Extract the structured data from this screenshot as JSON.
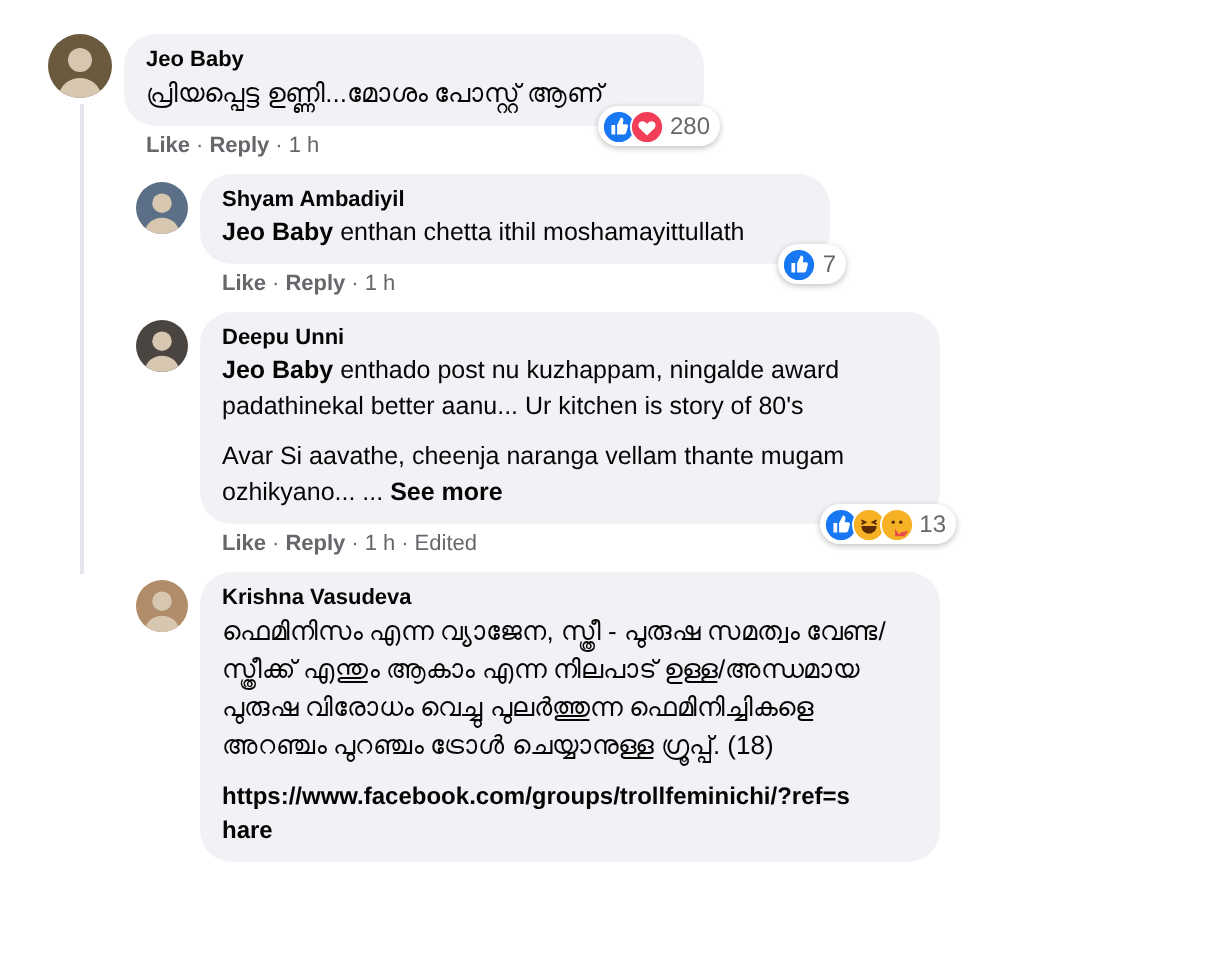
{
  "separator": "·",
  "comments": [
    {
      "author": "Jeo Baby",
      "reply": false,
      "paragraphs": [
        "പ്രിയപ്പെട്ട ഉണ്ണി...മോശം പോസ്റ്റ് ആണ്"
      ],
      "actions": [
        "Like",
        "Reply",
        "1 h"
      ],
      "reactions": {
        "icons": [
          {
            "kind": "like"
          },
          {
            "kind": "love"
          }
        ],
        "count": "280"
      }
    },
    {
      "author": "Shyam Ambadiyil",
      "reply": true,
      "paragraphs": [
        "**Jeo Baby** enthan chetta ithil moshamayittullath"
      ],
      "actions": [
        "Like",
        "Reply",
        "1 h"
      ],
      "reactions": {
        "icons": [
          {
            "kind": "like"
          }
        ],
        "count": "7"
      }
    },
    {
      "author": "Deepu Unni",
      "reply": true,
      "paragraphs": [
        "**Jeo Baby** enthado post nu kuzhappam, ningalde award padathinekal better aanu... Ur kitchen is story of 80's",
        "Avar Si aavathe, cheenja naranga vellam thante mugam ozhikyano... ..."
      ],
      "see_more": "See more",
      "actions": [
        "Like",
        "Reply",
        "1 h",
        "Edited"
      ],
      "reactions": {
        "icons": [
          {
            "kind": "like"
          },
          {
            "kind": "haha"
          },
          {
            "kind": "care"
          }
        ],
        "count": "13"
      }
    },
    {
      "author": "Krishna Vasudeva",
      "reply": true,
      "paragraphs": [
        "ഫെമിനിസം എന്ന വ്യാജേന, സ്ത്രീ - പുരുഷ സമത്വം വേണ്ട/സ്ത്രീക്ക് എന്തും ആകാം എന്ന നിലപാട് ഉള്ള/അന്ധമായ പുരുഷ വിരോധം വെച്ചു പുലർത്തുന്ന ഫെമിനിച്ചികളെ അറഞ്ചം പുറഞ്ചം ട്രോൾ ചെയ്യാനുള്ള ഗ്രൂപ്പ്. (18)"
      ],
      "link": "https://www.facebook.com/groups/trollfeminichi/?ref=share"
    }
  ]
}
